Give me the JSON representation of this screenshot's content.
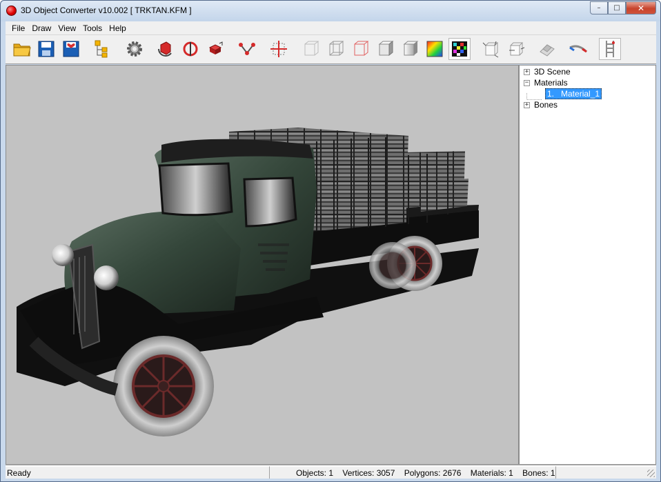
{
  "window": {
    "title": "3D Object Converter v10.002     [ TRKTAN.KFM ]",
    "buttons": {
      "minimize": "–",
      "maximize": "□",
      "close": "✕"
    }
  },
  "menu": [
    {
      "id": "file",
      "label": "File"
    },
    {
      "id": "draw",
      "label": "Draw"
    },
    {
      "id": "view",
      "label": "View"
    },
    {
      "id": "tools",
      "label": "Tools"
    },
    {
      "id": "help",
      "label": "Help"
    }
  ],
  "toolbar": {
    "buttons": [
      {
        "icon": "open-folder-icon"
      },
      {
        "icon": "save-icon"
      },
      {
        "icon": "save-as-icon"
      },
      {
        "icon": "hierarchy-icon"
      },
      {
        "icon": "settings-gear-icon"
      },
      {
        "icon": "rotate-icon"
      },
      {
        "icon": "rotate-axis-icon"
      },
      {
        "icon": "move-icon"
      },
      {
        "icon": "bones-icon"
      },
      {
        "icon": "pivot-icon"
      },
      {
        "icon": "wireframe-hidden-icon"
      },
      {
        "icon": "wireframe-icon"
      },
      {
        "icon": "wireframe-red-icon"
      },
      {
        "icon": "flat-shaded-icon"
      },
      {
        "icon": "smooth-shaded-icon"
      },
      {
        "icon": "color-shaded-icon"
      },
      {
        "icon": "textured-icon",
        "pressed": true
      },
      {
        "icon": "vertex-normals-icon"
      },
      {
        "icon": "face-normals-icon"
      },
      {
        "icon": "uv-map-icon"
      },
      {
        "icon": "camera-icon"
      },
      {
        "icon": "ladder-icon",
        "pressed": true
      }
    ]
  },
  "tree": {
    "items": [
      {
        "label": "3D Scene",
        "expander": "+"
      },
      {
        "label": "Materials",
        "expander": "−"
      },
      {
        "index": "1.",
        "label": "Material_1",
        "selected": true
      },
      {
        "label": "Bones",
        "expander": "+"
      }
    ]
  },
  "status": {
    "ready": "Ready",
    "stats": "Objects: 1    Vertices: 3057    Polygons: 2676    Materials: 1    Bones: 1"
  },
  "colors": {
    "viewport_bg": "#c2c2c2",
    "truck_cab": "#34463a",
    "tree_selection": "#3399ff"
  }
}
